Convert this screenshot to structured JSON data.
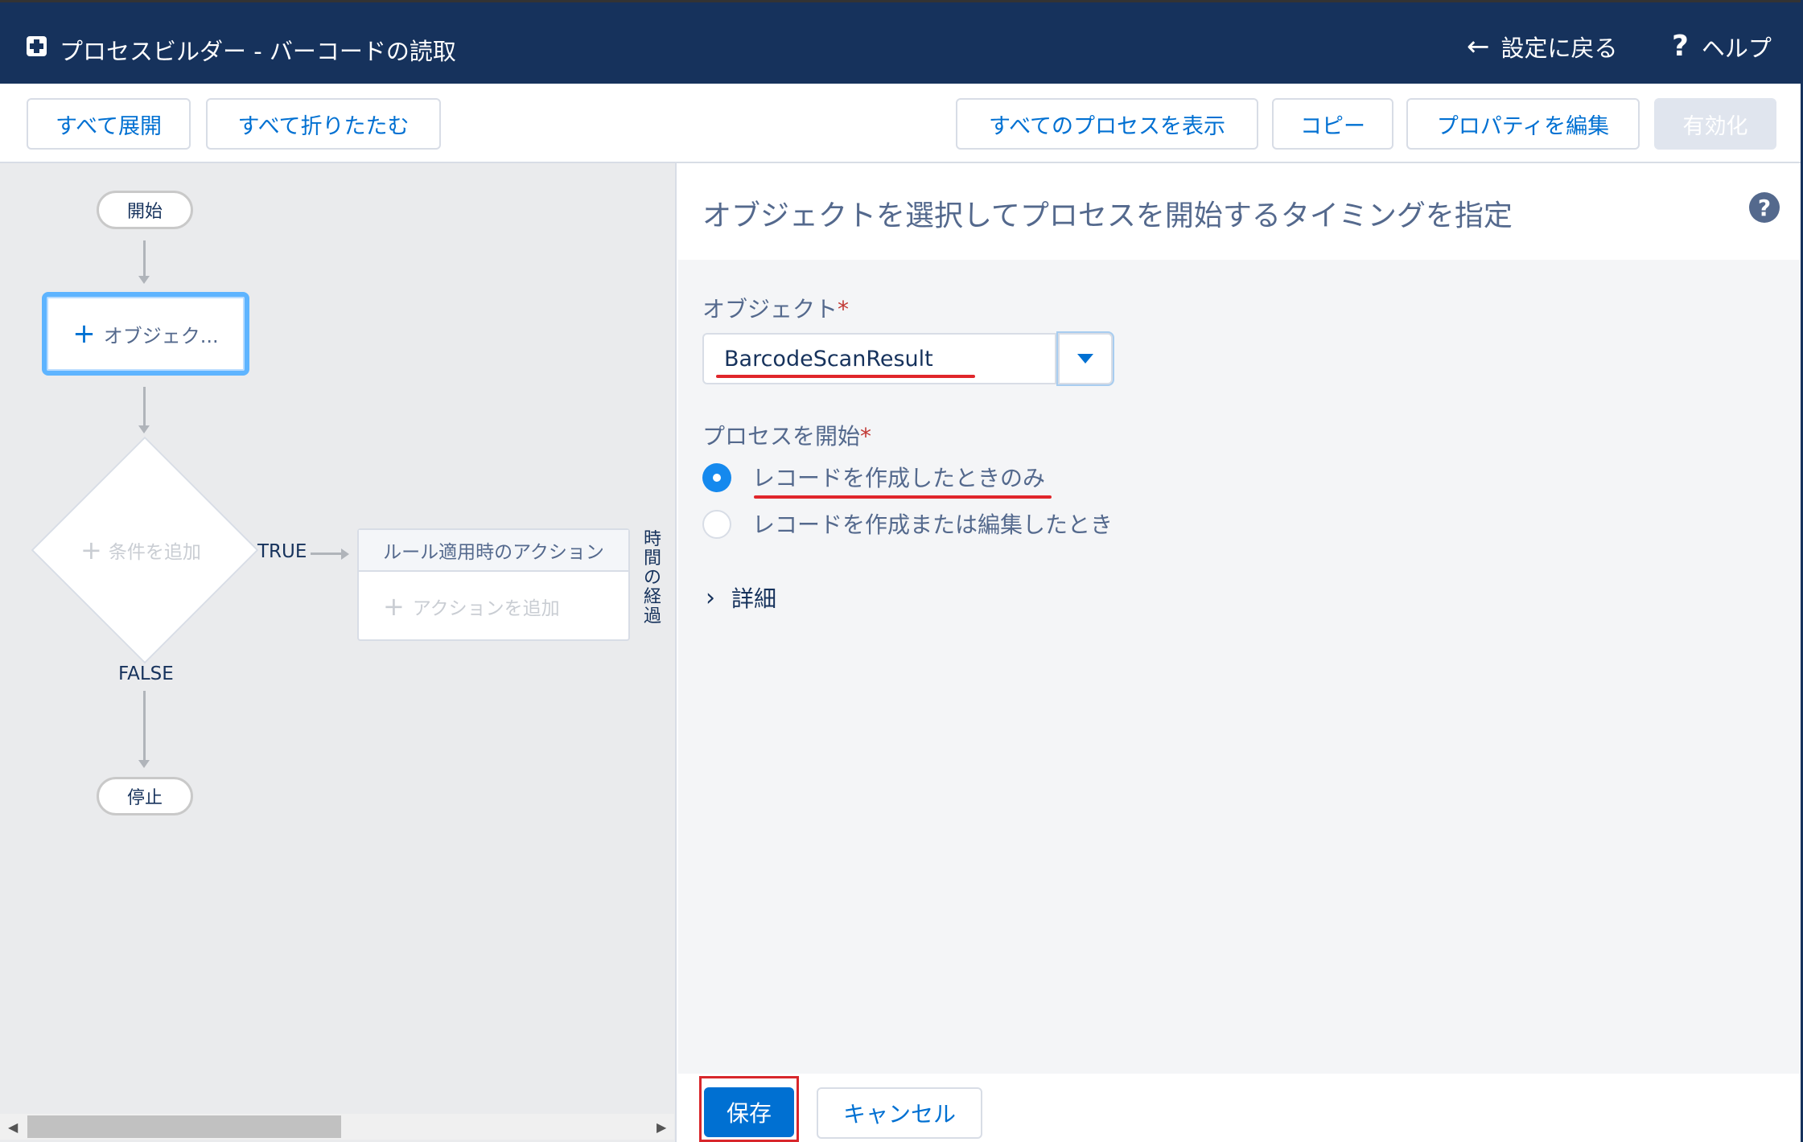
{
  "header": {
    "title": "プロセスビルダー - バーコードの読取",
    "back_label": "設定に戻る",
    "help_label": "ヘルプ",
    "app_icon": "process-builder-icon"
  },
  "toolbar": {
    "expand_all": "すべて展開",
    "collapse_all": "すべて折りたたむ",
    "view_all_processes": "すべてのプロセスを表示",
    "copy": "コピー",
    "edit_properties": "プロパティを編集",
    "activate": "有効化"
  },
  "canvas": {
    "start_label": "開始",
    "object_node_label": "オブジェク...",
    "criteria_label": "条件を追加",
    "true_label": "TRUE",
    "false_label": "FALSE",
    "immediate_actions_label": "ルール適用時のアクション",
    "add_action_label": "アクションを追加",
    "scheduled_actions_label": "時間の経過",
    "stop_label": "停止"
  },
  "panel": {
    "title": "オブジェクトを選択してプロセスを開始するタイミングを指定",
    "object_label": "オブジェクト",
    "object_value": "BarcodeScanResult",
    "start_process_label": "プロセスを開始",
    "required_marker": "*",
    "radio_options": [
      {
        "label": "レコードを作成したときのみ",
        "checked": true
      },
      {
        "label": "レコードを作成または編集したとき",
        "checked": false
      }
    ],
    "details_label": "詳細",
    "save_label": "保存",
    "cancel_label": "キャンセル"
  },
  "colors": {
    "header_bg": "#16325c",
    "brand_blue": "#0070d2",
    "highlight_red": "#d8262b",
    "radio_selected": "#1589ee"
  }
}
